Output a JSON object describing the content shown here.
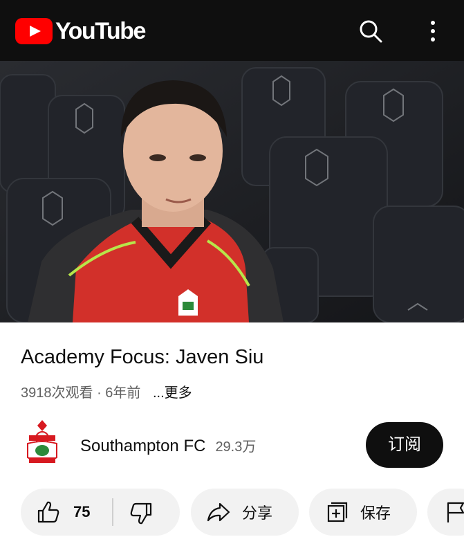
{
  "header": {
    "logo_text": "YouTube",
    "search_icon": "search-icon",
    "more_icon": "more-vert-icon"
  },
  "video": {
    "title": "Academy Focus: Javen Siu",
    "views": "3918次观看",
    "separator": "·",
    "age": "6年前",
    "more_label": "...更多"
  },
  "channel": {
    "name": "Southampton FC",
    "subscribers": "29.3万",
    "subscribe_label": "订阅"
  },
  "actions": {
    "like_count": "75",
    "share_label": "分享",
    "save_label": "保存"
  },
  "colors": {
    "brand_red": "#ff0000",
    "header_bg": "#0f0f0f",
    "subscribe_bg": "#0f0f0f",
    "pill_bg": "#f2f2f2"
  }
}
